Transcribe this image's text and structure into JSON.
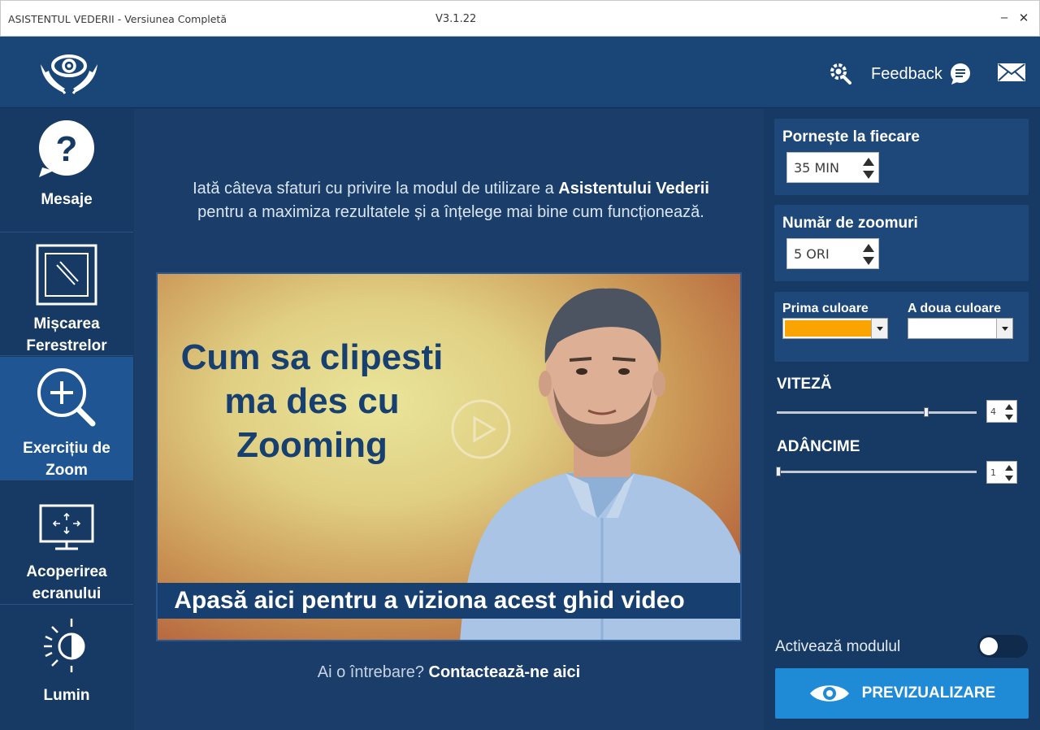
{
  "window": {
    "title": "ASISTENTUL VEDERII - Versiunea Completă",
    "version": "V3.1.22",
    "minimize": "–",
    "close": "✕"
  },
  "header": {
    "feedback_label": "Feedback"
  },
  "sidebar": {
    "items": [
      {
        "label": "Mesaje",
        "icon": "question-bubble-icon"
      },
      {
        "label": "Mișcarea Ferestrelor",
        "icon": "window-move-icon"
      },
      {
        "label": "Exercițiu de Zoom",
        "icon": "zoom-in-icon",
        "active": true
      },
      {
        "label": "Acoperirea ecranului",
        "icon": "screen-cover-icon"
      },
      {
        "label": "Lumin",
        "icon": "brightness-icon"
      }
    ]
  },
  "main": {
    "intro_before": "Iată câteva sfaturi cu privire la modul de utilizare a ",
    "intro_bold": "Asistentului Vederii",
    "intro_after": "pentru a maximiza rezultatele și a înțelege mai bine cum funcționează.",
    "video": {
      "headline_line1": "Cum sa clipesti",
      "headline_line2": "ma des cu",
      "headline_line3": "Zooming",
      "caption": "Apasă aici pentru a viziona acest ghid video"
    },
    "question_prefix": "Ai o întrebare? ",
    "question_link": "Contactează-ne aici"
  },
  "settings": {
    "start_every": {
      "label": "Pornește la fiecare",
      "value": "35 MIN"
    },
    "zoom_count": {
      "label": "Număr de zoomuri",
      "value": "5 ORI"
    },
    "first_color": {
      "label": "Prima culoare",
      "value": "#f9a400"
    },
    "second_color": {
      "label": "A doua culoare",
      "value": "#ffffff"
    },
    "speed": {
      "label": "VITEZĂ",
      "value": "4",
      "level": 0.74
    },
    "depth": {
      "label": "ADÂNCIME",
      "value": "1",
      "level": 0.0
    },
    "toggle_label": "Activează modulul",
    "toggle_on": false,
    "preview_label": "PREVIZUALIZARE"
  }
}
